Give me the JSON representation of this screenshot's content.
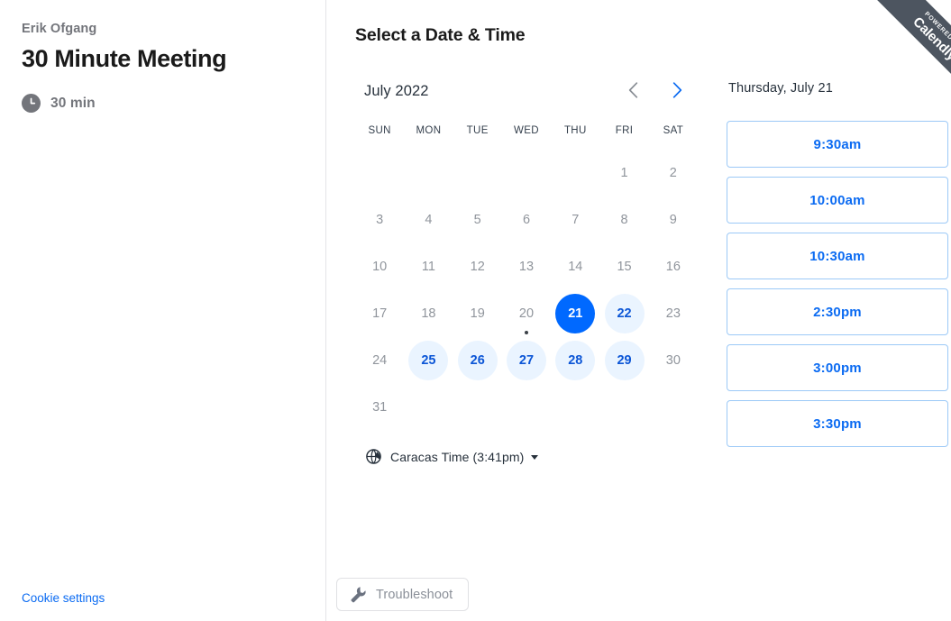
{
  "left": {
    "host_name": "Erik Ofgang",
    "event_title": "30 Minute Meeting",
    "duration": "30 min",
    "clock_icon": "clock-icon",
    "cookie_settings": "Cookie settings"
  },
  "main": {
    "section_title": "Select a Date & Time",
    "troubleshoot_label": "Troubleshoot",
    "wrench_icon": "wrench-icon"
  },
  "calendar": {
    "month_label": "July 2022",
    "prev_icon": "chevron-left-icon",
    "next_icon": "chevron-right-icon",
    "prev_enabled": false,
    "next_enabled": true,
    "weekdays": [
      "SUN",
      "MON",
      "TUE",
      "WED",
      "THU",
      "FRI",
      "SAT"
    ],
    "leading_blanks": 5,
    "days": [
      {
        "n": "1",
        "state": "disabled"
      },
      {
        "n": "2",
        "state": "disabled"
      },
      {
        "n": "3",
        "state": "disabled"
      },
      {
        "n": "4",
        "state": "disabled"
      },
      {
        "n": "5",
        "state": "disabled"
      },
      {
        "n": "6",
        "state": "disabled"
      },
      {
        "n": "7",
        "state": "disabled"
      },
      {
        "n": "8",
        "state": "disabled"
      },
      {
        "n": "9",
        "state": "disabled"
      },
      {
        "n": "10",
        "state": "disabled"
      },
      {
        "n": "11",
        "state": "disabled"
      },
      {
        "n": "12",
        "state": "disabled"
      },
      {
        "n": "13",
        "state": "disabled"
      },
      {
        "n": "14",
        "state": "disabled"
      },
      {
        "n": "15",
        "state": "disabled"
      },
      {
        "n": "16",
        "state": "disabled"
      },
      {
        "n": "17",
        "state": "disabled"
      },
      {
        "n": "18",
        "state": "disabled"
      },
      {
        "n": "19",
        "state": "disabled"
      },
      {
        "n": "20",
        "state": "disabled",
        "today": true
      },
      {
        "n": "21",
        "state": "selected"
      },
      {
        "n": "22",
        "state": "available"
      },
      {
        "n": "23",
        "state": "disabled"
      },
      {
        "n": "24",
        "state": "disabled"
      },
      {
        "n": "25",
        "state": "available"
      },
      {
        "n": "26",
        "state": "available"
      },
      {
        "n": "27",
        "state": "available"
      },
      {
        "n": "28",
        "state": "available"
      },
      {
        "n": "29",
        "state": "available"
      },
      {
        "n": "30",
        "state": "disabled"
      },
      {
        "n": "31",
        "state": "disabled"
      }
    ],
    "timezone": {
      "label": "Caracas Time (3:41pm)",
      "globe_icon": "globe-icon"
    }
  },
  "slots": {
    "date_header": "Thursday, July 21",
    "times": [
      "9:30am",
      "10:00am",
      "10:30am",
      "2:30pm",
      "3:00pm",
      "3:30pm"
    ]
  },
  "ribbon": {
    "top_text": "POWERED BY",
    "main_text": "Calendly"
  },
  "colors": {
    "accent_blue": "#0069ff",
    "link_blue": "#0b6bf2",
    "slot_border": "#9cc9f7",
    "available_fill": "#eaf4ff",
    "available_text": "#0b55d6",
    "disabled_text": "#90959c",
    "ribbon_bg": "#4d5560",
    "divider": "#e4e4e7",
    "muted_text": "#73757b"
  }
}
